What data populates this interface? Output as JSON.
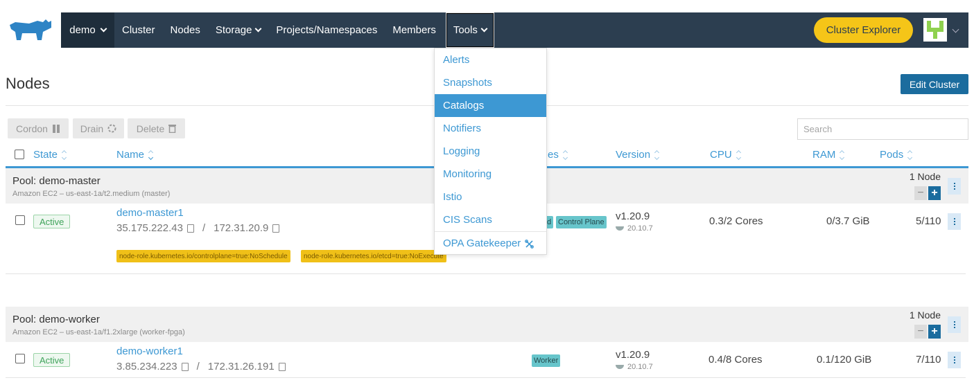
{
  "header": {
    "cluster": "demo",
    "nav": [
      "Cluster",
      "Nodes",
      "Storage",
      "Projects/Namespaces",
      "Members"
    ],
    "tools_label": "Tools",
    "explorer_label": "Cluster Explorer"
  },
  "tools_menu": {
    "items": [
      "Alerts",
      "Snapshots",
      "Catalogs",
      "Notifiers",
      "Logging",
      "Monitoring",
      "Istio",
      "CIS Scans"
    ],
    "active": "Catalogs",
    "gatekeeper": "OPA Gatekeeper"
  },
  "page": {
    "title": "Nodes",
    "edit_label": "Edit Cluster",
    "cordon_label": "Cordon",
    "drain_label": "Drain",
    "delete_label": "Delete",
    "search_placeholder": "Search"
  },
  "columns": {
    "state": "State",
    "name": "Name",
    "roles_partial": "es",
    "version": "Version",
    "cpu": "CPU",
    "ram": "RAM",
    "pods": "Pods"
  },
  "pools": [
    {
      "name": "Pool: demo-master",
      "desc": "Amazon EC2 – us-east-1a/t2.medium (master)",
      "count": "1 Node",
      "node": {
        "state": "Active",
        "name": "demo-master1",
        "public_ip": "35.175.222.43",
        "sep": "/",
        "private_ip": "172.31.20.9",
        "taints": [
          "node-role.kubernetes.io/controlplane=true:NoSchedule",
          "node-role.kubernetes.io/etcd=true:NoExecute"
        ],
        "roles": [
          "d",
          "Control Plane"
        ],
        "version": "v1.20.9",
        "docker": "20.10.7",
        "cpu": "0.3/2 Cores",
        "ram": "0/3.7 GiB",
        "pods": "5/110"
      }
    },
    {
      "name": "Pool: demo-worker",
      "desc": "Amazon EC2 – us-east-1a/f1.2xlarge (worker-fpga)",
      "count": "1 Node",
      "node": {
        "state": "Active",
        "name": "demo-worker1",
        "public_ip": "3.85.234.223",
        "sep": "/",
        "private_ip": "172.31.26.191",
        "roles": [
          "Worker"
        ],
        "version": "v1.20.9",
        "docker": "20.10.7",
        "cpu": "0.4/8 Cores",
        "ram": "0.1/120 GiB",
        "pods": "7/110"
      }
    }
  ],
  "colors": {
    "topbar": "#2c3e50",
    "accent": "#3d98d3",
    "explorer": "#f5c518",
    "primary_button": "#1b6c9e"
  }
}
